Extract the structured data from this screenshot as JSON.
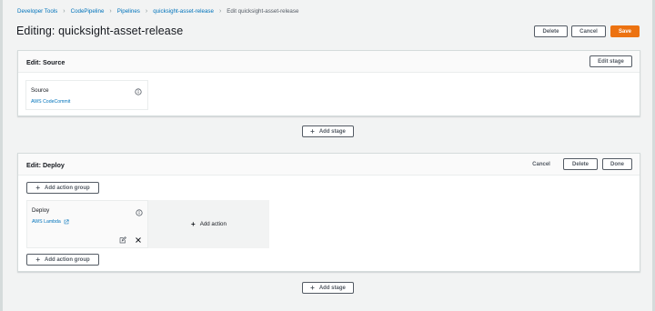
{
  "breadcrumb": {
    "items": [
      "Developer Tools",
      "CodePipeline",
      "Pipelines",
      "quicksight-asset-release"
    ],
    "current": "Edit quicksight-asset-release"
  },
  "page": {
    "title": "Editing: quicksight-asset-release"
  },
  "header_actions": {
    "delete": "Delete",
    "cancel": "Cancel",
    "save": "Save"
  },
  "stages": [
    {
      "title": "Edit: Source",
      "edit_stage": "Edit stage",
      "actions": [
        {
          "name": "Source",
          "provider": "AWS CodeCommit"
        }
      ]
    },
    {
      "title": "Edit: Deploy",
      "cancel": "Cancel",
      "delete": "Delete",
      "done": "Done",
      "add_action_group": "Add action group",
      "add_action": "Add action",
      "actions": [
        {
          "name": "Deploy",
          "provider": "AWS Lambda"
        }
      ]
    }
  ],
  "add_stage_label": "Add stage",
  "colors": {
    "primary": "#ec7211",
    "link": "#0073bb",
    "background": "#f2f3f3"
  }
}
